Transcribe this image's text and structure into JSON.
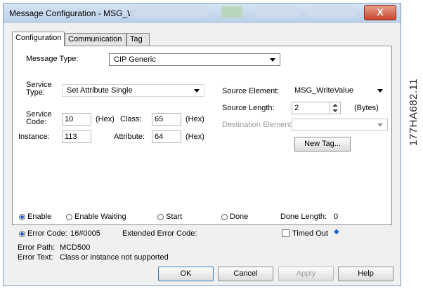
{
  "window": {
    "title": "Message Configuration - MSG_W",
    "close_glyph": "X"
  },
  "side_label": "177HA682.11",
  "tabs": [
    {
      "label": "Configuration"
    },
    {
      "label": "Communication"
    },
    {
      "label": "Tag"
    }
  ],
  "config": {
    "message_type_label": "Message Type:",
    "message_type_value": "CIP Generic",
    "service_type_label_1": "Service",
    "service_type_label_2": "Type:",
    "service_type_value": "Set Attribute Single",
    "service_code_label_1": "Service",
    "service_code_label_2": "Code:",
    "service_code_value": "10",
    "hex": "(Hex)",
    "class_label": "Class:",
    "class_value": "65",
    "instance_label": "Instance:",
    "instance_value": "113",
    "attribute_label": "Attribute:",
    "attribute_value": "64",
    "source_element_label": "Source Element:",
    "source_element_value": "MSG_WriteValue",
    "source_length_label": "Source Length:",
    "source_length_value": "2",
    "bytes": "(Bytes)",
    "destination_element_label": "Destination Element:",
    "destination_element_value": "",
    "new_tag_label": "New Tag..."
  },
  "status": {
    "enable_label": "Enable",
    "enable_waiting_label": "Enable Waiting",
    "start_label": "Start",
    "done_label": "Done",
    "done_length_label": "Done Length:",
    "done_length_value": "0",
    "error_code_label": "Error Code:",
    "error_code_value": "16#0005",
    "extended_error_label": "Extended Error Code:",
    "timed_out_label": "Timed Out",
    "error_path_label": "Error Path:",
    "error_path_value": "MCD500",
    "error_text_label": "Error Text:",
    "error_text_value": "Class or instance not supported",
    "enable_checked": true,
    "error_code_checked": true,
    "timed_out_checked": false
  },
  "buttons": {
    "ok": "OK",
    "cancel": "Cancel",
    "apply": "Apply",
    "help": "Help"
  },
  "colors": {
    "title_gradient_top": "#d6e4f3",
    "close_button": "#c9462d",
    "radio_fill": "#1b5fcc"
  }
}
